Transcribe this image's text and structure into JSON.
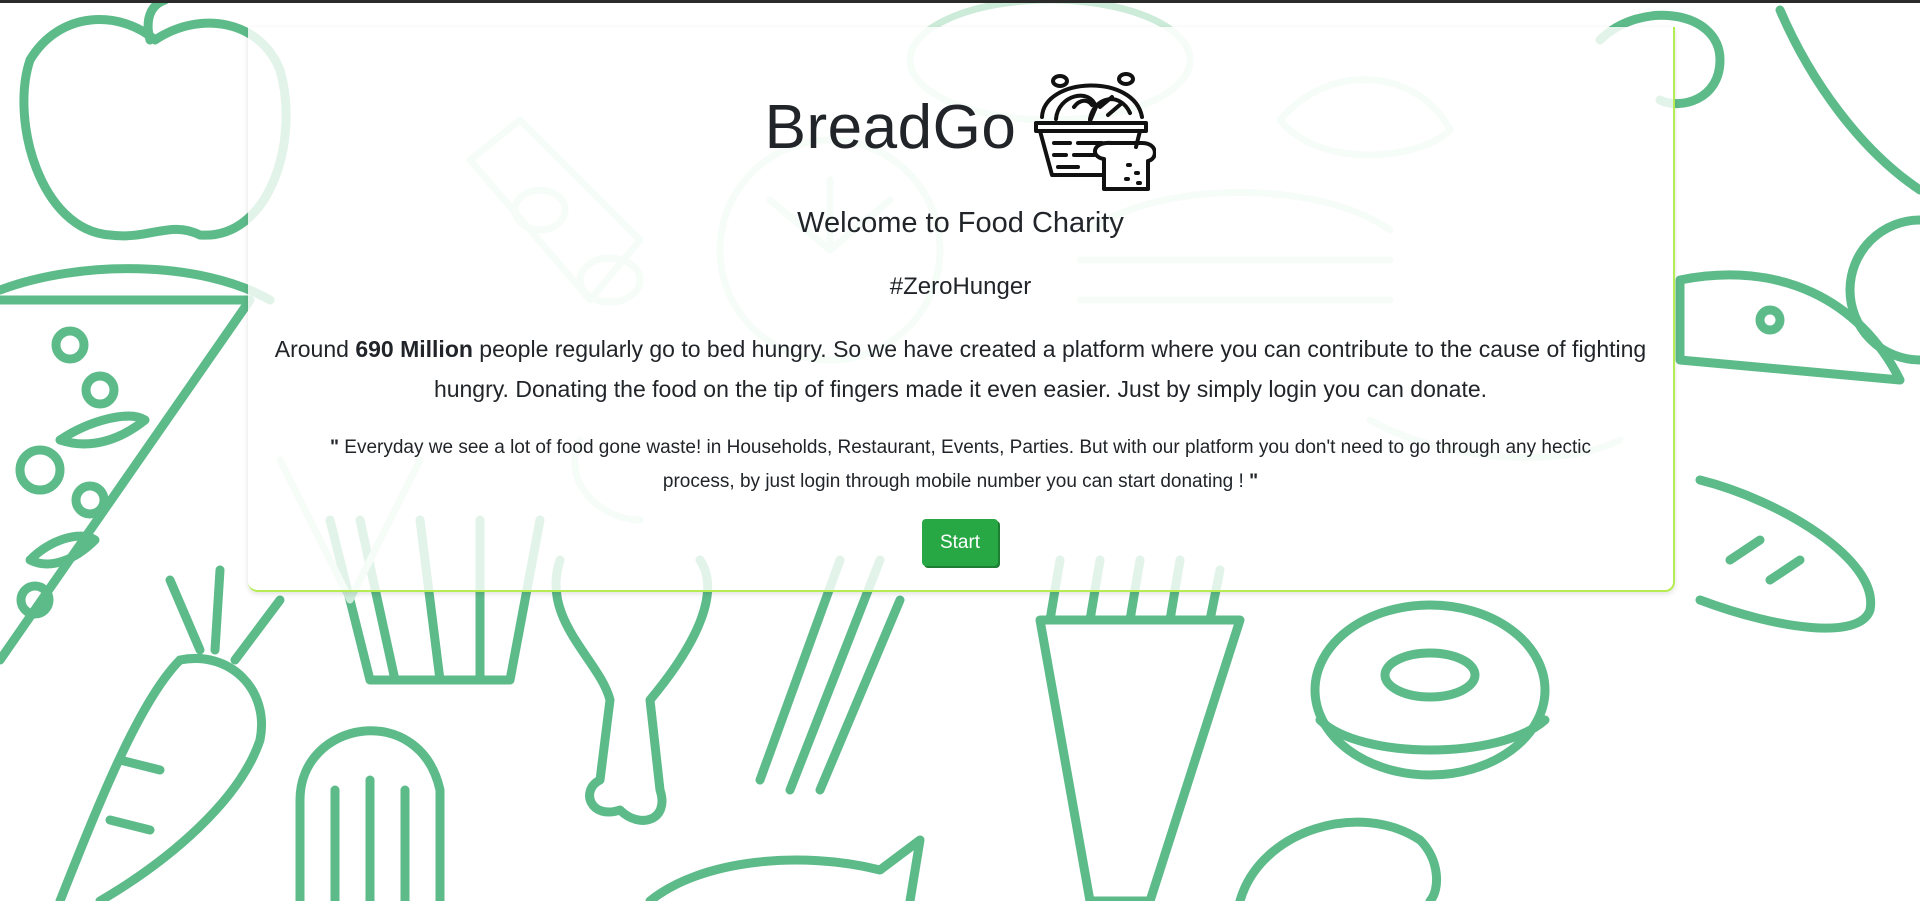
{
  "brand": {
    "title": "BreadGo",
    "logo_icon": "bread-basket-icon"
  },
  "hero": {
    "welcome": "Welcome to Food Charity",
    "hashtag": "#ZeroHunger",
    "paragraph_prefix": "Around ",
    "paragraph_bold": "690 Million",
    "paragraph_suffix": " people regularly go to bed hungry. So we have created a platform where you can contribute to the cause of fighting hungry. Donating the food on the tip of fingers made it even easier. Just by simply login you can donate.",
    "quote_open": "\"",
    "quote_text": " Everyday we see a lot of food gone waste! in Households, Restaurant, Events, Parties. But with our platform you don't need to go through any hectic process, by just login through mobile number you can start donating ! ",
    "quote_close": "\"",
    "start_label": "Start"
  },
  "colors": {
    "doodle_green": "#5dbb8a",
    "accent_lime": "#b4ec51",
    "button_green": "#28a745",
    "text_dark": "#212529"
  },
  "background_pattern": "food-doodle-pattern"
}
